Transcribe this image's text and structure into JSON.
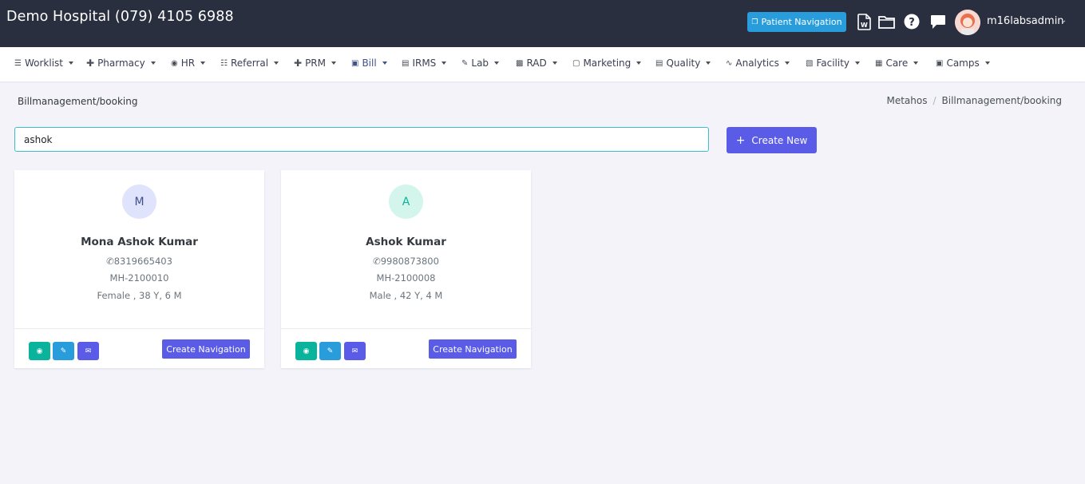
{
  "header": {
    "title": "Demo Hospital (079) 4105 6988",
    "patient_navigation_label": "Patient Navigation",
    "username": "m16labsadmin",
    "icons": [
      "word-doc-icon",
      "folder-icon",
      "help-icon",
      "chat-icon"
    ]
  },
  "nav": {
    "items": [
      {
        "label": "Worklist",
        "icon": "list-icon"
      },
      {
        "label": "Pharmacy",
        "icon": "plus-icon"
      },
      {
        "label": "HR",
        "icon": "user-circle-icon"
      },
      {
        "label": "Referral",
        "icon": "user-list-icon"
      },
      {
        "label": "PRM",
        "icon": "plus-icon"
      },
      {
        "label": "Bill",
        "icon": "bill-icon",
        "active": true
      },
      {
        "label": "IRMS",
        "icon": "card-icon"
      },
      {
        "label": "Lab",
        "icon": "pen-icon"
      },
      {
        "label": "RAD",
        "icon": "file-icon"
      },
      {
        "label": "Marketing",
        "icon": "bag-icon"
      },
      {
        "label": "Quality",
        "icon": "card-icon"
      },
      {
        "label": "Analytics",
        "icon": "pulse-icon"
      },
      {
        "label": "Facility",
        "icon": "building-icon"
      },
      {
        "label": "Care",
        "icon": "bed-icon"
      },
      {
        "label": "Camps",
        "icon": "briefcase-icon"
      }
    ],
    "active_color": "#405189"
  },
  "page": {
    "title": "Billmanagement/booking",
    "breadcrumb": [
      "Metahos",
      "Billmanagement/booking"
    ]
  },
  "search": {
    "value": "ashok",
    "create_label": "Create New"
  },
  "patients": [
    {
      "initial": "M",
      "name": "Mona Ashok Kumar",
      "phone": "8319665403",
      "mrn": "MH-2100010",
      "demographics": "Female , 38 Y, 6 M",
      "avatar_bg": "#dfe3fb",
      "avatar_fg": "#405189",
      "nav_label": "Create Navigation"
    },
    {
      "initial": "A",
      "name": "Ashok Kumar",
      "phone": "9980873800",
      "mrn": "MH-2100008",
      "demographics": "Male , 42 Y, 4 M",
      "avatar_bg": "#d4f5ec",
      "avatar_fg": "#0ab39c",
      "nav_label": "Create Navigation"
    }
  ],
  "colors": {
    "topbar": "#2a2f3f",
    "primary": "#5a5be6",
    "success": "#0ab39c",
    "info": "#299cdb"
  }
}
